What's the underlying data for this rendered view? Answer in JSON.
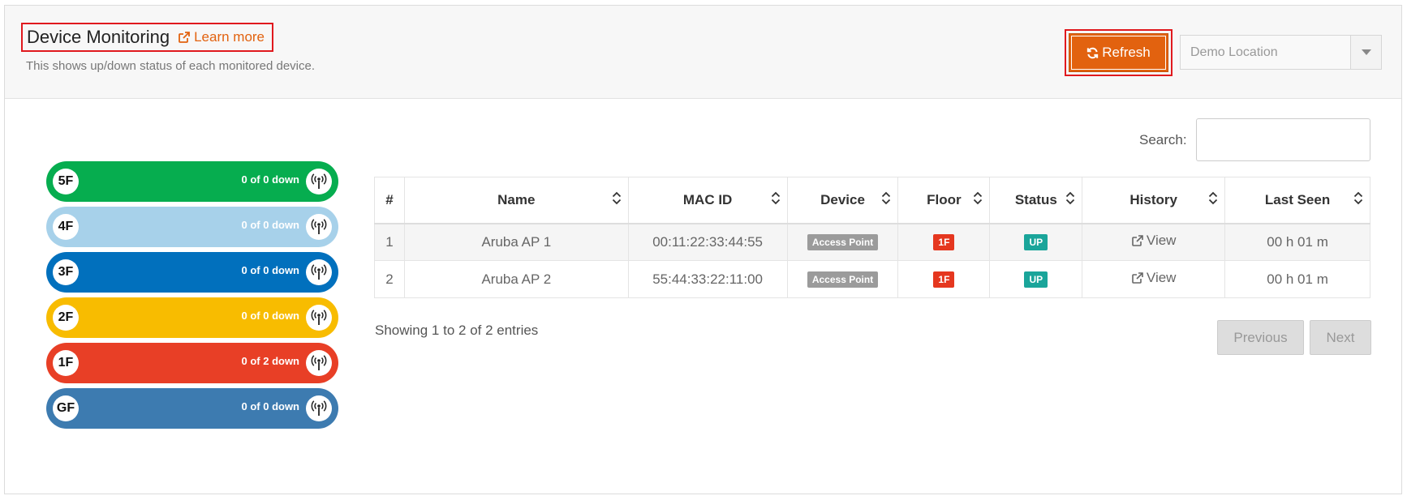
{
  "header": {
    "title": "Device Monitoring",
    "learn_more": "Learn more",
    "subtitle": "This shows up/down status of each monitored device.",
    "refresh_label": "Refresh",
    "location_value": "Demo Location"
  },
  "floors": [
    {
      "label": "5F",
      "count": "0 of 0 down",
      "color": "#06ad4f"
    },
    {
      "label": "4F",
      "count": "0 of 0 down",
      "color": "#a7d1ea"
    },
    {
      "label": "3F",
      "count": "0 of 0 down",
      "color": "#0170bd"
    },
    {
      "label": "2F",
      "count": "0 of 0 down",
      "color": "#f8bc00"
    },
    {
      "label": "1F",
      "count": "0 of 2 down",
      "color": "#e83f26"
    },
    {
      "label": "GF",
      "count": "0 of 0 down",
      "color": "#3d7bb0"
    }
  ],
  "search": {
    "label": "Search:",
    "value": ""
  },
  "table": {
    "columns": [
      "#",
      "Name",
      "MAC ID",
      "Device",
      "Floor",
      "Status",
      "History",
      "Last Seen"
    ],
    "rows": [
      {
        "num": "1",
        "name": "Aruba AP 1",
        "mac": "00:11:22:33:44:55",
        "device": "Access Point",
        "floor": "1F",
        "status": "UP",
        "history": "View",
        "last_seen": "00 h 01 m"
      },
      {
        "num": "2",
        "name": "Aruba AP 2",
        "mac": "55:44:33:22:11:00",
        "device": "Access Point",
        "floor": "1F",
        "status": "UP",
        "history": "View",
        "last_seen": "00 h 01 m"
      }
    ]
  },
  "footer": {
    "showing": "Showing 1 to 2 of 2 entries",
    "previous": "Previous",
    "next": "Next"
  },
  "colors": {
    "accent": "#e2620f",
    "highlight_border": "#e0191e",
    "floor_tag": "#e5371f",
    "status_up": "#1aa59a",
    "device_tag": "#9b9b9b"
  },
  "icons": {
    "learn_more": "external-link-icon",
    "refresh": "refresh-icon",
    "location_select": "caret-down-icon",
    "floor": "wifi-antenna-icon",
    "sort": "sort-icon",
    "history": "external-link-icon"
  }
}
